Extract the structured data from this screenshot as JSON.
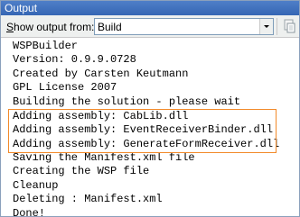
{
  "window": {
    "title": "Output"
  },
  "toolbar": {
    "show_output_label_prefix": "S",
    "show_output_label_rest": "how output from:",
    "source_value": "Build",
    "dropdown_icon": "chevron-down-icon",
    "action_icon": "copy-icon"
  },
  "output": {
    "lines": [
      "WSPBuilder",
      "Version: 0.9.9.0728",
      "Created by Carsten Keutmann",
      "GPL License 2007",
      "Building the solution - please wait",
      "Adding assembly: CabLib.dll",
      "Adding assembly: EventReceiverBinder.dll",
      "Adding assembly: GenerateFormReceiver.dll",
      "Saving the Manifest.xml file",
      "Creating the WSP file",
      "Cleanup",
      "Deleting : Manifest.xml",
      "Done!"
    ],
    "highlight_color": "#f28a2a"
  }
}
